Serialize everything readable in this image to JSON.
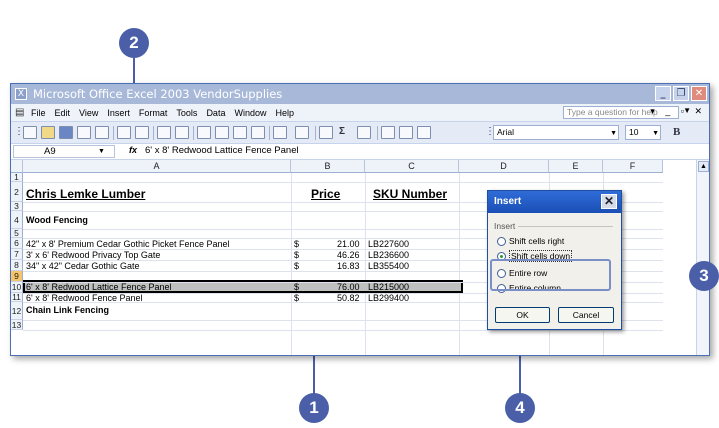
{
  "window": {
    "title": "Microsoft Office Excel 2003 VendorSupplies",
    "title_buttons": [
      "_",
      "❐",
      "✕"
    ]
  },
  "menu": {
    "items": [
      "File",
      "Edit",
      "View",
      "Insert",
      "Format",
      "Tools",
      "Data",
      "Window",
      "Help"
    ],
    "help_placeholder": "Type a question for help",
    "controls": "▾ _ ▫ ✕"
  },
  "toolbar": {
    "font_name": "Arial",
    "font_size": "10",
    "bold_label": "B"
  },
  "formula_bar": {
    "name_box": "A9",
    "fx": "fx",
    "value": "6' x 8' Redwood Lattice Fence Panel"
  },
  "columns": [
    "A",
    "B",
    "C",
    "D",
    "E",
    "F"
  ],
  "rows": [
    {
      "num": "1",
      "a": "",
      "b_sym": "",
      "b_val": "",
      "c": ""
    },
    {
      "num": "2",
      "a": "Chris Lemke Lumber",
      "b_sym": "Price",
      "b_val": "",
      "c": "SKU Number"
    },
    {
      "num": "3",
      "a": "",
      "b_sym": "",
      "b_val": "",
      "c": ""
    },
    {
      "num": "4",
      "a": "Wood Fencing",
      "b_sym": "",
      "b_val": "",
      "c": ""
    },
    {
      "num": "5",
      "a": "",
      "b_sym": "",
      "b_val": "",
      "c": ""
    },
    {
      "num": "6",
      "a": "42\" x 8' Premium Cedar Gothic Picket Fence Panel",
      "b_sym": "$",
      "b_val": "21.00",
      "c": "LB227600"
    },
    {
      "num": "7",
      "a": "3' x 6' Redwood Privacy Top Gate",
      "b_sym": "$",
      "b_val": "46.26",
      "c": "LB236600"
    },
    {
      "num": "8",
      "a": "34\" x 42\" Cedar Gothic Gate",
      "b_sym": "$",
      "b_val": "16.83",
      "c": "LB355400"
    },
    {
      "num": "9",
      "a": "6' x 8' Redwood Lattice Fence Panel",
      "b_sym": "$",
      "b_val": "76.00",
      "c": "LB215000"
    },
    {
      "num": "10",
      "a": "6' x 8' Redwood Fence Panel",
      "b_sym": "$",
      "b_val": "50.82",
      "c": "LB299400"
    },
    {
      "num": "11",
      "a": "",
      "b_sym": "",
      "b_val": "",
      "c": ""
    },
    {
      "num": "12",
      "a": "Chain Link Fencing",
      "b_sym": "",
      "b_val": "",
      "c": ""
    },
    {
      "num": "13",
      "a": "",
      "b_sym": "",
      "b_val": "",
      "c": ""
    }
  ],
  "dialog": {
    "title": "Insert",
    "close": "✕",
    "group_label": "Insert",
    "options": [
      {
        "label": "Shift cells right",
        "selected": false
      },
      {
        "label": "Shift cells down",
        "selected": true
      },
      {
        "label": "Entire row",
        "selected": false
      },
      {
        "label": "Entire column",
        "selected": false
      }
    ],
    "ok_label": "OK",
    "cancel_label": "Cancel"
  },
  "callouts": {
    "c1": "1",
    "c2": "2",
    "c3": "3",
    "c4": "4"
  },
  "colors": {
    "callout": "#4a5fa8",
    "titlebar": "#a7b8d8",
    "dialog_title": "#2f6cd8"
  }
}
